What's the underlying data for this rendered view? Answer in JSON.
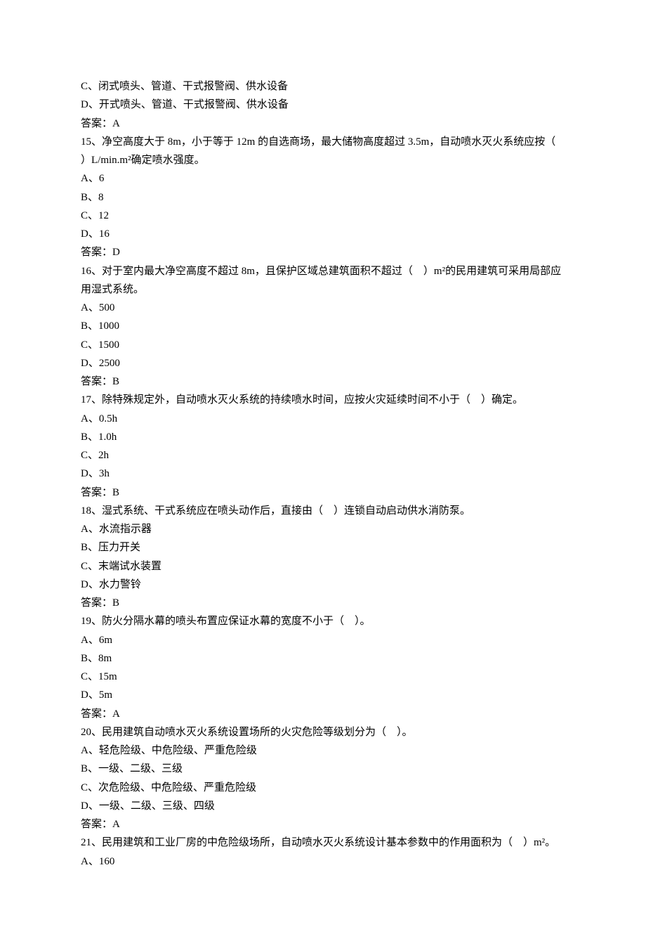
{
  "lines": [
    "C、闭式喷头、管道、干式报警阀、供水设备",
    "D、开式喷头、管道、干式报警阀、供水设备",
    "答案：A",
    "15、净空高度大于 8m，小于等于 12m 的自选商场，最大储物高度超过 3.5m，自动喷水灭火系统应按（    ）L/min.m²确定喷水强度。",
    "A、6",
    "B、8",
    "C、12",
    "D、16",
    "答案：D",
    "16、对于室内最大净空高度不超过 8m，且保护区域总建筑面积不超过（    ）m²的民用建筑可采用局部应用湿式系统。",
    "A、500",
    "B、1000",
    "C、1500",
    "D、2500",
    "答案：B",
    "17、除特殊规定外，自动喷水灭火系统的持续喷水时间，应按火灾延续时间不小于（    ）确定。",
    "A、0.5h",
    "B、1.0h",
    "C、2h",
    "D、3h",
    "答案：B",
    "18、湿式系统、干式系统应在喷头动作后，直接由（    ）连锁自动启动供水消防泵。",
    "A、水流指示器",
    "B、压力开关",
    "C、末端试水装置",
    "D、水力警铃",
    "答案：B",
    "19、防火分隔水幕的喷头布置应保证水幕的宽度不小于（    ）。",
    "A、6m",
    "B、8m",
    "C、15m",
    "D、5m",
    "答案：A",
    "20、民用建筑自动喷水灭火系统设置场所的火灾危险等级划分为（    ）。",
    "A、轻危险级、中危险级、严重危险级",
    "B、一级、二级、三级",
    "C、次危险级、中危险级、严重危险级",
    "D、一级、二级、三级、四级",
    "答案：A",
    "21、民用建筑和工业厂房的中危险级场所，自动喷水灭火系统设计基本参数中的作用面积为（    ）m²。",
    "A、160"
  ]
}
